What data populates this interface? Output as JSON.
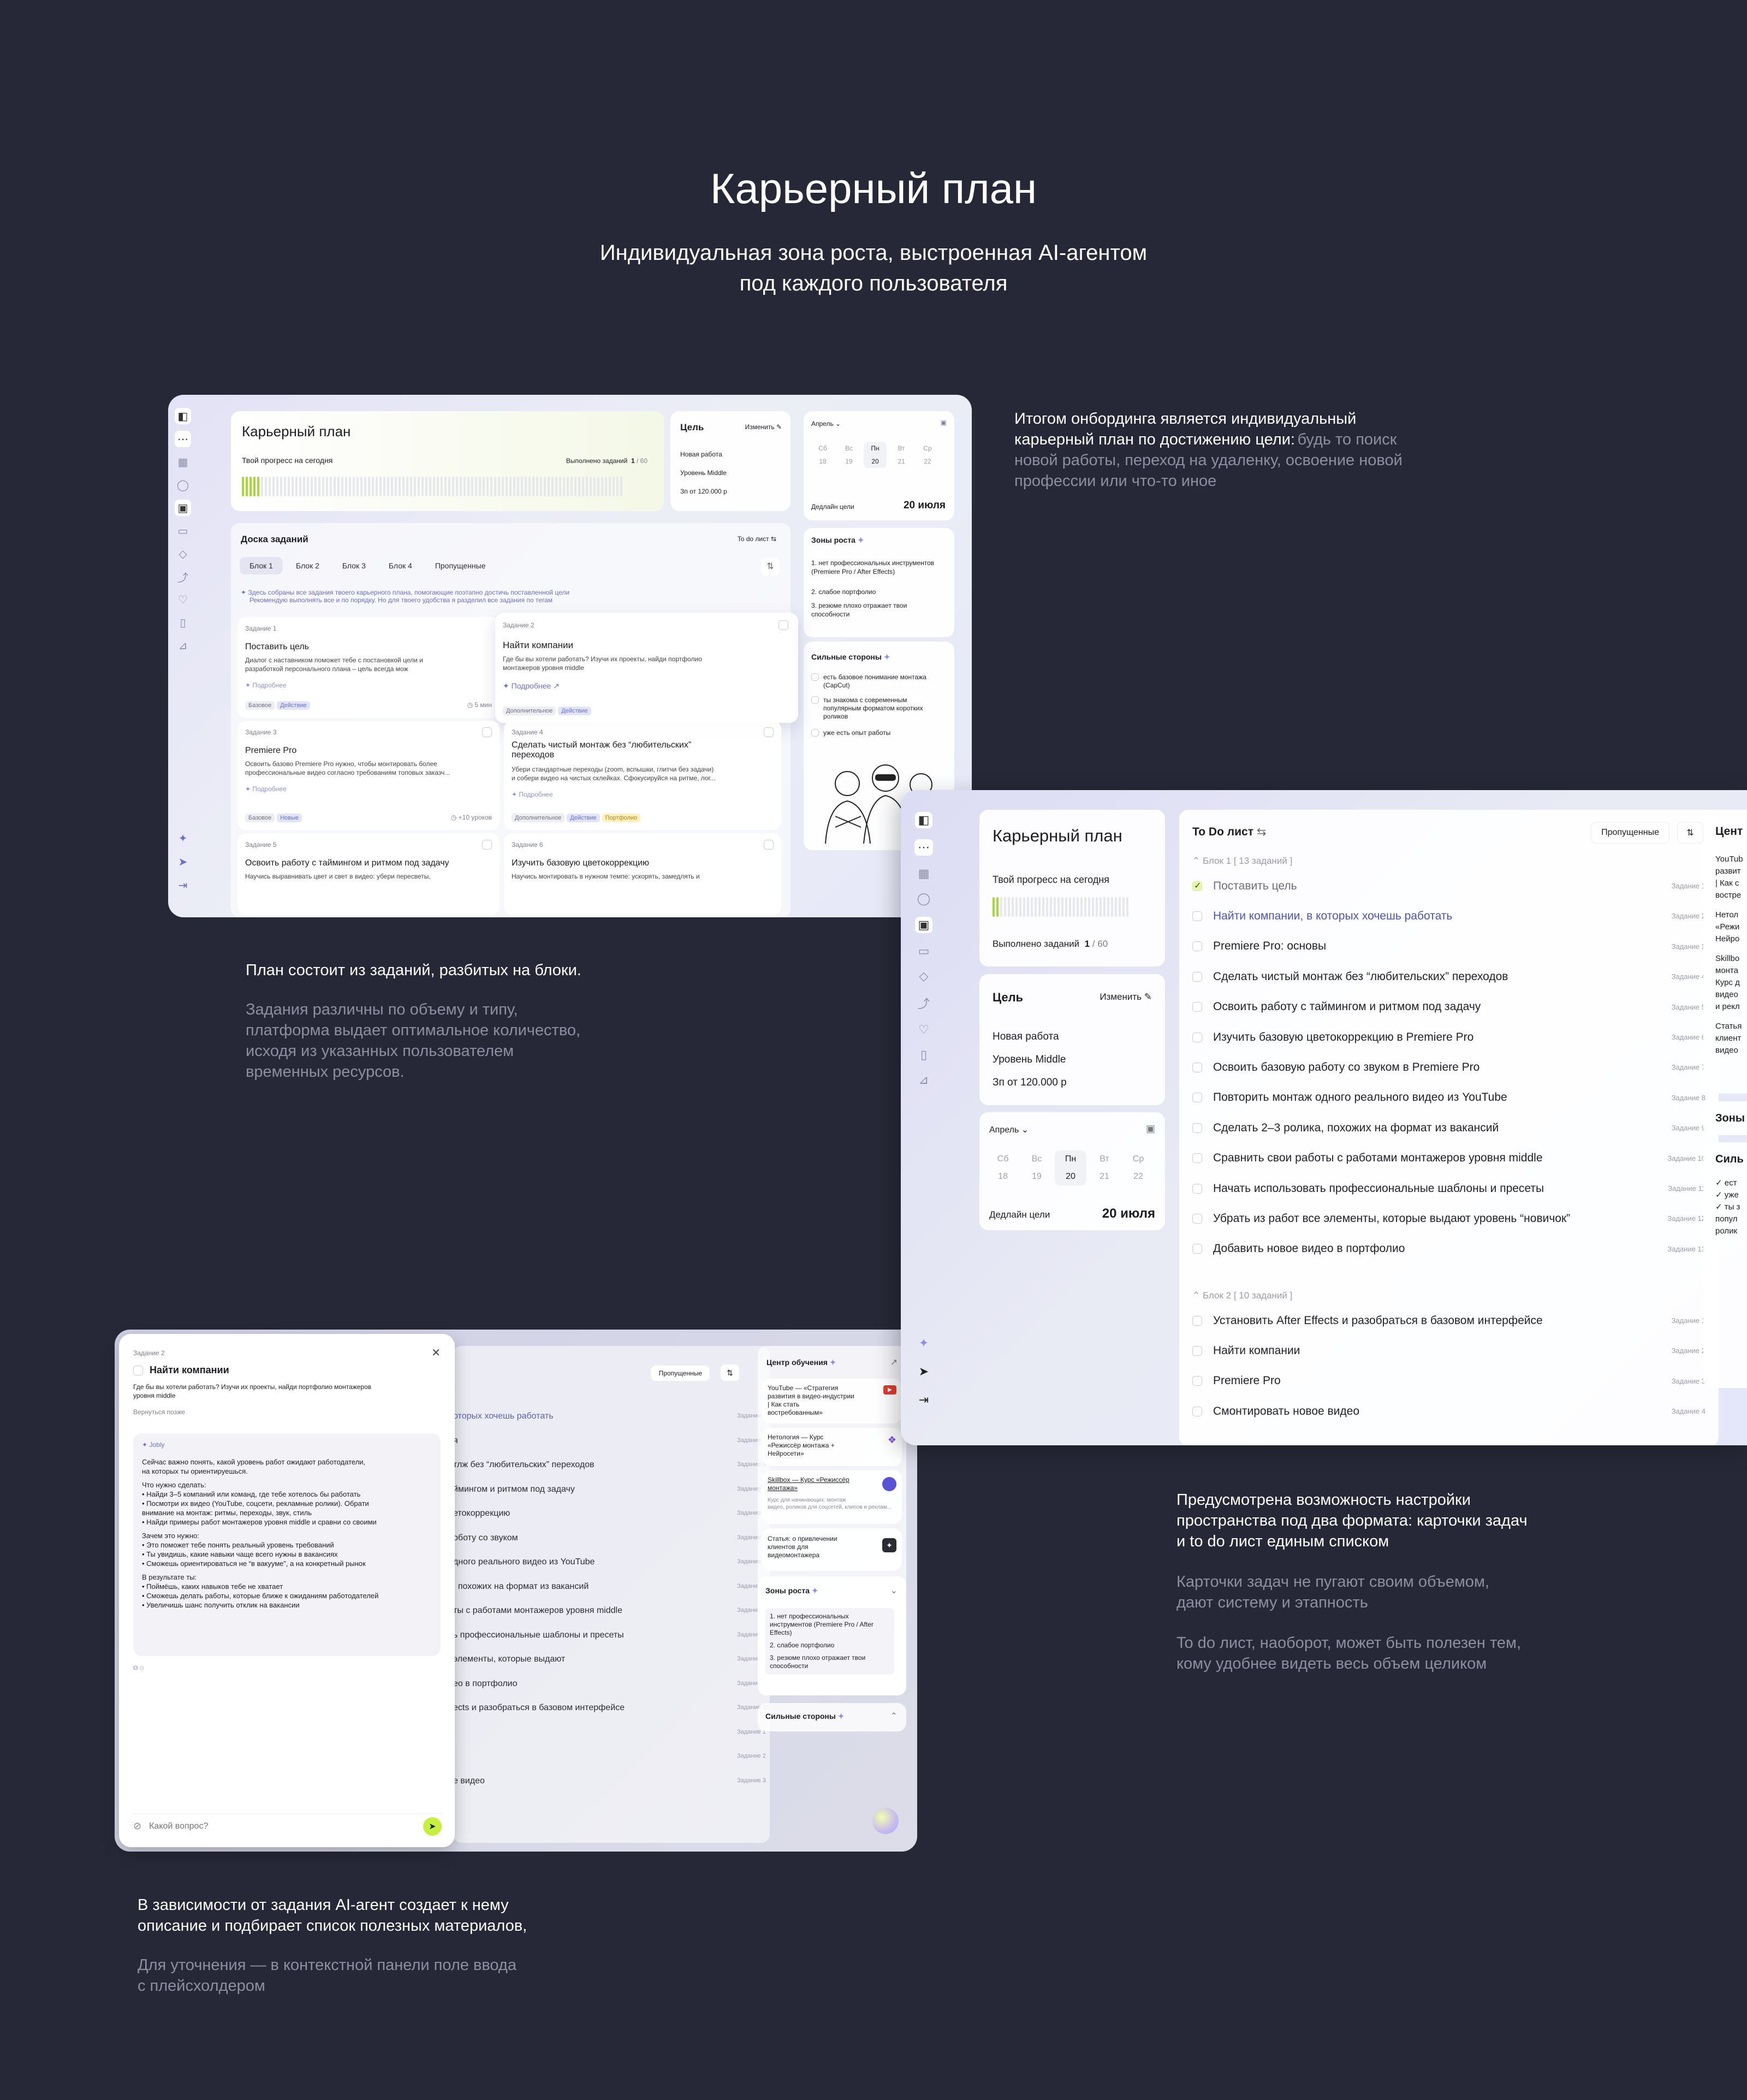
{
  "hero": {
    "title": "Карьерный план",
    "subtitle_1": "Индивидуальная зона роста, выстроенная AI-агентом",
    "subtitle_2": "под каждого пользователя"
  },
  "desc1": {
    "white_1": "Итогом онбординга является индивидуальный",
    "white_2": "карьерный план по достижению цели:",
    "gray_inline": "будь то поиск",
    "gray_2": "новой работы, переход на удаленку, освоение новой",
    "gray_3": "профессии или что-то иное"
  },
  "desc2": {
    "white": "План состоит из заданий, разбитых на блоки.",
    "gray_1": "Задания различны по объему и типу,",
    "gray_2": "платформа выдает оптимальное количество,",
    "gray_3": "исходя из указанных пользователем",
    "gray_4": "временных ресурсов."
  },
  "desc3": {
    "white_1": "Предусмотрена возможность настройки",
    "white_2": "пространства под два формата: карточки задач",
    "white_3": "и to do лист единым списком",
    "gray_1": "Карточки задач не пугают своим объемом,",
    "gray_2": "дают систему и этапность",
    "gray_3": "To do лист, наоборот, может быть полезен тем,",
    "gray_4": "кому удобнее видеть весь объем целиком"
  },
  "desc4": {
    "white_1": "В зависимости от задания AI-агент создает к нему",
    "white_2": "описание и подбирает список полезных материалов,",
    "gray_1": "Для уточнения — в контекстной панели поле ввода",
    "gray_2": "с плейсхолдером"
  },
  "plan": {
    "title": "Карьерный план",
    "progress_label": "Твой прогресс на сегодня",
    "done_label": "Выполнено заданий",
    "done": "1",
    "total": "/ 60",
    "bars_filled": 0.0167
  },
  "goal": {
    "title": "Цель",
    "edit": "Изменить",
    "items": [
      "Новая работа",
      "Уровень Middle",
      "Зп от 120.000 р"
    ]
  },
  "calendar": {
    "month": "Апрель",
    "days": [
      {
        "d": "Сб",
        "n": "18"
      },
      {
        "d": "Вс",
        "n": "19"
      },
      {
        "d": "Пн",
        "n": "20"
      },
      {
        "d": "Вт",
        "n": "21"
      },
      {
        "d": "Ср",
        "n": "22"
      }
    ],
    "deadline_label": "Дедлайн цели",
    "deadline": "20 июля"
  },
  "board": {
    "title": "Доска заданий",
    "todo_link": "To do лист",
    "tabs": [
      "Блок 1",
      "Блок 2",
      "Блок 3",
      "Блок 4",
      "Пропущенные"
    ],
    "hint_1": "Здесь собраны все задания твоего карьерного плана, помогающие поэтапно достичь поставленной цели",
    "hint_2": "Рекомендую выполнять все и по порядку. Но для твоего удобства я разделил все задания по тегам",
    "more": "Подробнее",
    "cards": [
      {
        "num": "Задание 1",
        "title": "Поставить цель",
        "text_1": "Диалог с наставником поможет тебе с постановкой цели и",
        "text_2": "разработкой персонального плана – цель всегда мож",
        "tags": [
          "Базовое",
          "Действие"
        ],
        "meta": "5 мин"
      },
      {
        "num": "Задание 2",
        "title": "Найти компании",
        "text_1": "Где бы вы хотели работать? Изучи их проекты, найди портфолио",
        "text_2": "монтажеров уровня middle",
        "tags": [
          "Дополнительное",
          "Действие"
        ],
        "meta": ""
      },
      {
        "num": "Задание 3",
        "title": "Premiere Pro",
        "text_1": "Освоить базово Premiere Pro нужно, чтобы монтировать более",
        "text_2": "профессиональные видео согласно требованиям топовых заказч...",
        "tags": [
          "Базовое",
          "Новые"
        ],
        "meta": "+10 уроков"
      },
      {
        "num": "Задание 4",
        "title": "Сделать чистый монтаж без “любительских” переходов",
        "text_1": "Убери стандартные переходы (zoom, вспышки, глитчи без задачи)",
        "text_2": "и собери видео на чистых склейках. Сфокусируйся на ритме, лог...",
        "tags": [
          "Дополнительное",
          "Действие",
          "Портфолио"
        ],
        "meta": ""
      },
      {
        "num": "Задание 5",
        "title": "Освоить работу с таймингом и ритмом под задачу",
        "text_1": "Научись выравнивать цвет и свет в видео: убери пересветы,",
        "text_2": "",
        "tags": [],
        "meta": ""
      },
      {
        "num": "Задание 6",
        "title": "Изучить базовую цветокоррекцию",
        "text_1": "Научись монтировать в нужном темпе: ускорять, замедлять и",
        "text_2": "",
        "tags": [],
        "meta": ""
      }
    ]
  },
  "growth": {
    "title": "Зоны роста",
    "items": [
      "1. нет профессиональных инструментов (Premiere Pro / After Effects)",
      "2. слабое портфолио",
      "3. резюме плохо отражает твои способности"
    ]
  },
  "strengths": {
    "title": "Сильные стороны",
    "items": [
      "есть базовое понимание монтажа (CapCut)",
      "ты знакома с современным популярным форматом коротких роликов",
      "уже есть опыт работы"
    ]
  },
  "todo": {
    "title": "To Do лист",
    "missed": "Пропущенные",
    "block1": "Блок 1  [ 13 заданий ]",
    "block2": "Блок 2  [ 10 заданий ]",
    "items1": [
      {
        "t": "Поставить цель",
        "n": "Задание 1",
        "done": true
      },
      {
        "t": "Найти компании, в которых хочешь работать",
        "n": "Задание 2",
        "link": true
      },
      {
        "t": "Premiere Pro: основы",
        "n": "Задание 3"
      },
      {
        "t": "Сделать чистый монтаж без “любительских” переходов",
        "n": "Задание 4"
      },
      {
        "t": "Освоить работу с таймингом и ритмом под задачу",
        "n": "Задание 5"
      },
      {
        "t": "Изучить базовую цветокоррекцию в Premiere Pro",
        "n": "Задание 6"
      },
      {
        "t": "Освоить базовую работу со звуком в Premiere Pro",
        "n": "Задание 7"
      },
      {
        "t": "Повторить монтаж одного реального видео из YouTube",
        "n": "Задание 8"
      },
      {
        "t": "Сделать 2–3 ролика, похожих на формат из вакансий",
        "n": "Задание 9"
      },
      {
        "t": "Сравнить свои работы с работами монтажеров уровня middle",
        "n": "Задание 10"
      },
      {
        "t": "Начать использовать профессиональные шаблоны и пресеты",
        "n": "Задание 11"
      },
      {
        "t": "Убрать из работ все элементы, которые выдают уровень “новичок”",
        "n": "Задание 12"
      },
      {
        "t": "Добавить новое видео в портфолио",
        "n": "Задание 13"
      }
    ],
    "items2": [
      {
        "t": "Установить After Effects и разобраться в базовом интерфейсе",
        "n": "Задание 1"
      },
      {
        "t": "Найти компании",
        "n": "Задание 2"
      },
      {
        "t": "Premiere Pro",
        "n": "Задание 3"
      },
      {
        "t": "Смонтировать новое видео",
        "n": "Задание 4"
      }
    ]
  },
  "peek": {
    "title": "Цент",
    "lines": [
      "YouTub",
      "развит",
      "| Как с",
      "востре",
      "Нетол",
      "«Режи",
      "Нейро",
      "Skillbo",
      "монта",
      "Курс д",
      "видео",
      "и рекл",
      "Статья",
      "клиент",
      "видео"
    ],
    "zone": "Зоны",
    "strong": "Силь",
    "s_items": [
      "✓ ест",
      "✓ уже",
      "✓ ты з",
      "попул",
      "ролик"
    ]
  },
  "chat": {
    "num": "Задание 2",
    "title": "Найти компании",
    "text_1": "Где бы вы хотели работать? Изучи их проекты, найди портфолио монтажеров",
    "text_2": "уровня middle",
    "back": "Вернуться позже",
    "agent": "Jobly",
    "msg": [
      "Сейчас важно понять, какой уровень работ ожидают работодатели,",
      "на которых ты ориентируешься.",
      "Что нужно сделать:",
      "• Найди 3–5 компаний или команд, где тебе хотелось бы работать",
      "• Посмотри их видео (YouTube, соцсети, рекламные ролики). Обрати",
      "   внимание на монтаж: ритмы, переходы, звук, стиль",
      "• Найди примеры работ монтажеров уровня middle и сравни со своими",
      "Зачем это нужно:",
      "• Это поможет тебе понять реальный уровень требований",
      "• Ты увидишь, какие навыки чаще всего нужны в вакансиях",
      "• Сможешь ориентироваться не “в вакууме”, а на конкретный рынок",
      "В результате ты:",
      "• Поймёшь, каких навыков тебе не хватает",
      "• Сможешь делать работы, которые ближе к ожиданиям работодателей",
      "• Увеличишь шанс получить отклик на вакансии"
    ],
    "placeholder": "Какой вопрос?"
  },
  "learn": {
    "title": "Центр обучения",
    "items": [
      {
        "t1": "YouTube — «Стратегия",
        "t2": "развития в видео-индустрии",
        "t3": "| Как стать",
        "t4": "востребованным»"
      },
      {
        "t1": "Нетология — Курс",
        "t2": "«Режиссёр монтажа +",
        "t3": "Нейросети»",
        "t4": ""
      },
      {
        "t1": "Skillbox — Курс «Режиссёр",
        "t2": "монтажа»",
        "t3": "Курс для начинающих: монтаж",
        "t4": "видео, роликов для соцсетей, клипов и реклам..."
      },
      {
        "t1": "Статья: о привлечении",
        "t2": "клиентов для",
        "t3": "видеомонтажера",
        "t4": ""
      }
    ],
    "growth_title": "Зоны роста",
    "strengths_title": "Сильные стороны",
    "missed": "Пропущенные",
    "bg_rows": [
      "оторых хочешь работать",
      "я",
      "тлж без “любительских” переходов",
      "ймингом и ритмом под задачу",
      "етокоррекцию",
      "оботу со звуком",
      "дного реального видео из YouTube",
      ", похожих на формат из вакансий",
      "ты с работами монтажеров уровня middle",
      "ь профессиональные шаблоны и пресеты",
      "элементы, которые выдают",
      "ео в портфолио",
      "ects и разобраться в базовом интерфейсе",
      "",
      "",
      "е видео"
    ]
  }
}
